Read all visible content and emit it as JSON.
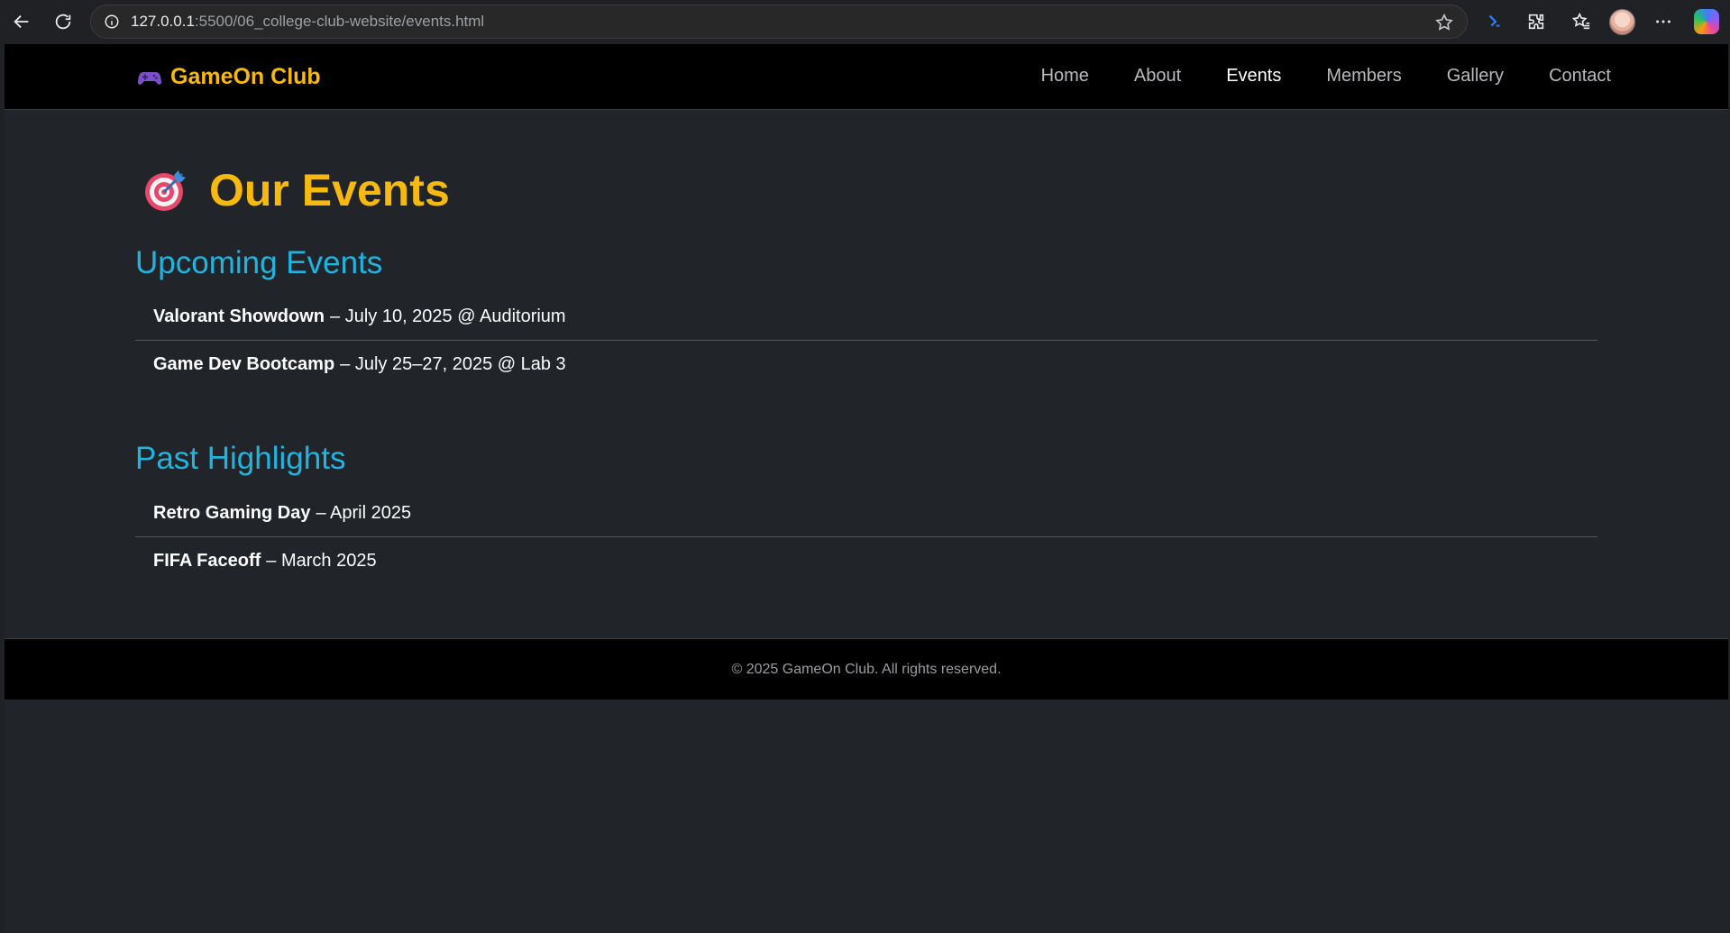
{
  "browser": {
    "url_host": "127.0.0.1",
    "url_rest": ":5500/06_college-club-website/events.html"
  },
  "header": {
    "logo_text": "GameOn Club",
    "nav": [
      {
        "label": "Home"
      },
      {
        "label": "About"
      },
      {
        "label": "Events"
      },
      {
        "label": "Members"
      },
      {
        "label": "Gallery"
      },
      {
        "label": "Contact"
      }
    ],
    "active_nav": "Events"
  },
  "main": {
    "title": "Our Events",
    "upcoming": {
      "heading": "Upcoming Events",
      "items": [
        {
          "name": "Valorant Showdown",
          "detail": "– July 10, 2025 @ Auditorium"
        },
        {
          "name": "Game Dev Bootcamp",
          "detail": "– July 25–27, 2025 @ Lab 3"
        }
      ]
    },
    "past": {
      "heading": "Past Highlights",
      "items": [
        {
          "name": "Retro Gaming Day",
          "detail": "– April 2025"
        },
        {
          "name": "FIFA Faceoff",
          "detail": "– March 2025"
        }
      ]
    }
  },
  "footer": {
    "text": "© 2025 GameOn Club. All rights reserved."
  },
  "colors": {
    "accent_yellow": "#f6b90f",
    "accent_cyan": "#1fb5e0",
    "page_bg": "#212429",
    "header_bg": "#000000"
  },
  "icons": [
    "back-icon",
    "reload-icon",
    "site-info-icon",
    "favorite-star-icon",
    "search-extension-icon",
    "extensions-icon",
    "favorites-icon",
    "profile-avatar",
    "more-icon",
    "copilot-icon",
    "gamepad-icon",
    "target-icon"
  ]
}
